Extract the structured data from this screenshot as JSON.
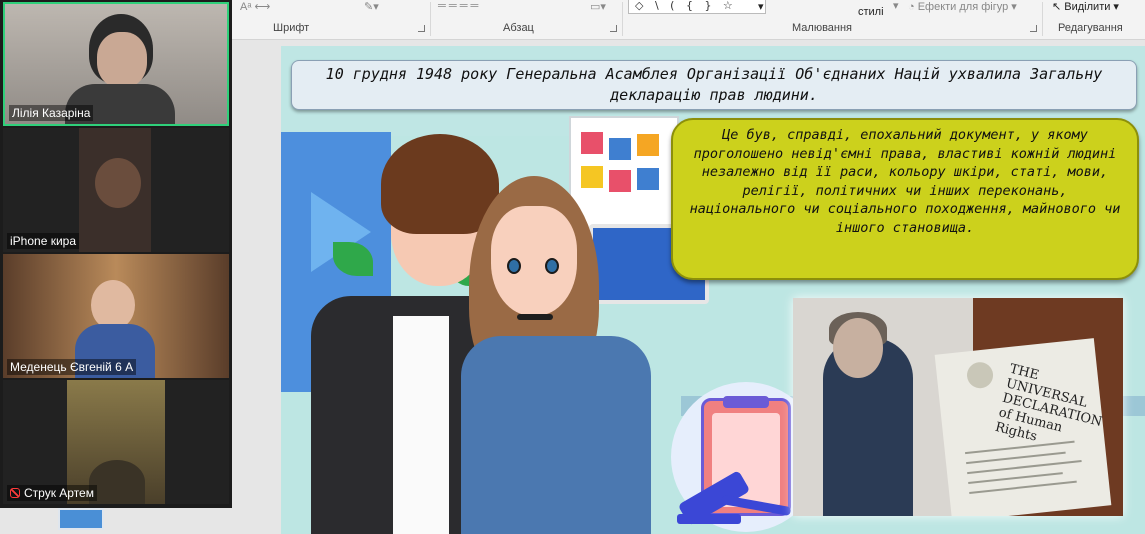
{
  "ribbon": {
    "groups": {
      "font_label": "Шрифт",
      "paragraph_label": "Абзац",
      "drawing_label": "Малювання",
      "editing_label": "Редагування"
    },
    "styles_label": "стилі",
    "shape_effects_label": "Ефекти для фігур",
    "select_label": "Виділити",
    "shapes_gallery_glyphs": "◇ \\ ( { } ☆"
  },
  "video_panel": {
    "participants": [
      {
        "name": "Лілія Казаріна",
        "active": true,
        "muted": false
      },
      {
        "name": "iPhone кира",
        "active": false,
        "muted": false
      },
      {
        "name": "Меденець Євгеній 6 А",
        "active": false,
        "muted": false
      },
      {
        "name": "Струк Артем",
        "active": false,
        "muted": true
      }
    ]
  },
  "slide": {
    "title": "10 грудня 1948 року Генеральна Асамблея Організації Об'єднаних Націй ухвалила Загальну декларацію прав людини.",
    "callout": "Це був, справді, епохальний документ, у якому проголошено невід'ємні права, властиві кожній людині незалежно від її раси, кольору шкіри, статі, мови, релігії, політичних чи інших переконань, національного чи соціального походження, майнового чи іншого становища.",
    "poster_text": "THE UNIVERSAL DECLARATION of Human Rights"
  },
  "colors": {
    "callout_bg": "#ccd11c",
    "active_speaker": "#2fd07a",
    "slide_bg": "#cfeeec"
  }
}
